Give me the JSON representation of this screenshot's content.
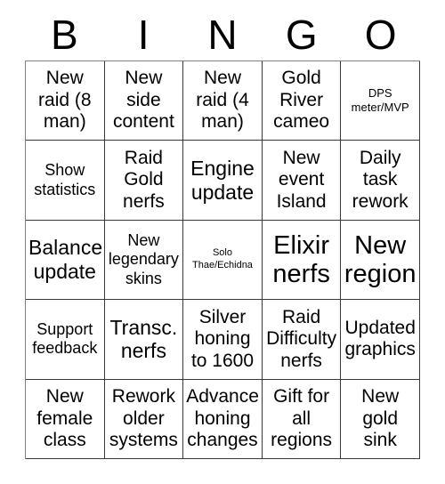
{
  "header": {
    "letters": [
      "B",
      "I",
      "N",
      "G",
      "O"
    ]
  },
  "grid": {
    "columns": 5,
    "rows": 5,
    "cells": [
      {
        "text": "New raid (8 man)",
        "size": "md"
      },
      {
        "text": "New side content",
        "size": "md"
      },
      {
        "text": "New raid (4 man)",
        "size": "md"
      },
      {
        "text": "Gold River cameo",
        "size": "md"
      },
      {
        "text": "DPS meter/MVP",
        "size": "xs"
      },
      {
        "text": "Show statistics",
        "size": "sm"
      },
      {
        "text": "Raid Gold nerfs",
        "size": "md"
      },
      {
        "text": "Engine update",
        "size": "lg"
      },
      {
        "text": "New event Island",
        "size": "md"
      },
      {
        "text": "Daily task rework",
        "size": "md"
      },
      {
        "text": "Balance update",
        "size": "lg"
      },
      {
        "text": "New legendary skins",
        "size": "sm"
      },
      {
        "text": "Solo Thae/Echidna",
        "size": "xxs"
      },
      {
        "text": "Elixir nerfs",
        "size": "xl"
      },
      {
        "text": "New region",
        "size": "xl"
      },
      {
        "text": "Support feedback",
        "size": "sm"
      },
      {
        "text": "Transc. nerfs",
        "size": "lg"
      },
      {
        "text": "Silver honing to 1600",
        "size": "md"
      },
      {
        "text": "Raid Difficulty nerfs",
        "size": "md"
      },
      {
        "text": "Updated graphics",
        "size": "md"
      },
      {
        "text": "New female class",
        "size": "md"
      },
      {
        "text": "Rework older systems",
        "size": "md"
      },
      {
        "text": "Advance honing changes",
        "size": "md"
      },
      {
        "text": "Gift for all regions",
        "size": "md"
      },
      {
        "text": "New gold sink",
        "size": "md"
      }
    ]
  },
  "colors": {
    "background": "#ffffff",
    "text": "#000000",
    "grid_line": "#3a3a3a"
  }
}
